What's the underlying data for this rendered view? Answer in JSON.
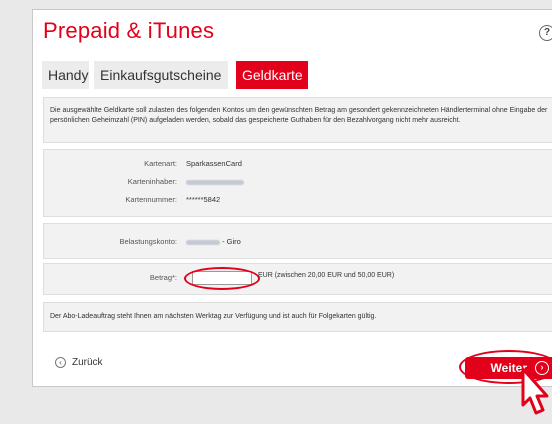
{
  "header": {
    "title": "Prepaid & iTunes",
    "help": "?"
  },
  "tabs": [
    {
      "label": "Handy"
    },
    {
      "label": "Einkaufsgutscheine"
    },
    {
      "label": "Geldkarte"
    }
  ],
  "info": {
    "text": "Die ausgewählte Geldkarte soll zulasten des folgenden Kontos um den gewünschten Betrag am gesondert gekennzeichneten Händlerterminal ohne Eingabe der persönlichen Geheimzahl (PIN) aufgeladen werden, sobald das gespeicherte Guthaben für den Bezahlvorgang nicht mehr ausreicht."
  },
  "card": {
    "type_label": "Kartenart:",
    "type_value": "SparkassenCard",
    "holder_label": "Karteninhaber:",
    "number_label": "Kartennummer:",
    "number_value": "******5842"
  },
  "account": {
    "label": "Belastungskonto:",
    "suffix": "- Giro"
  },
  "amount": {
    "label": "Betrag*:",
    "value": "",
    "hint": "EUR (zwischen 20,00 EUR und 50,00 EUR)"
  },
  "notice": {
    "text": "Der Abo-Ladeauftrag steht Ihnen am nächsten Werktag zur Verfügung und ist auch für Folgekarten gültig."
  },
  "actions": {
    "back_label": "Zurück",
    "next_label": "Weiter"
  },
  "colors": {
    "accent": "#e2001a"
  }
}
